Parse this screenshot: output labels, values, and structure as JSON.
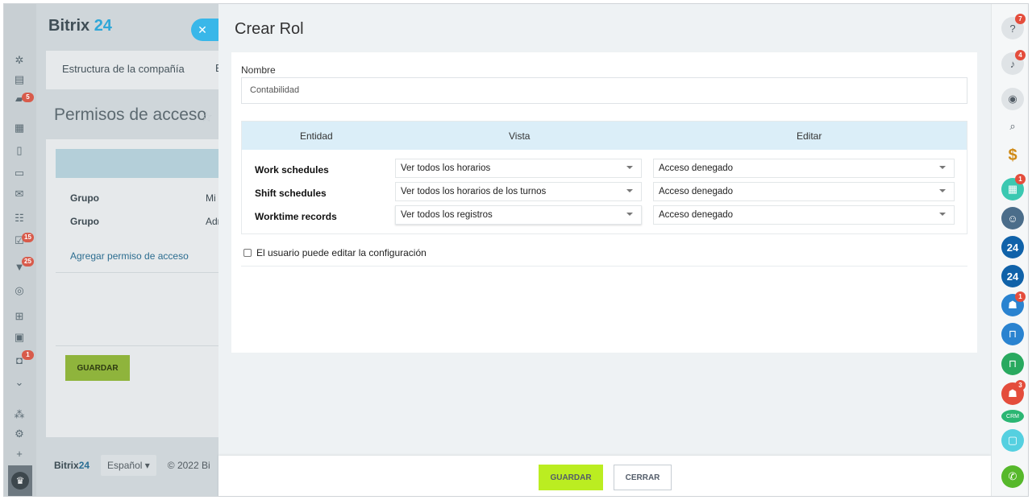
{
  "app": {
    "logo_name": "Bitrix",
    "logo_num": "24"
  },
  "background": {
    "tab_label": "Estructura de la compañía",
    "tab_label_partial": "E",
    "page_title": "Permisos de acceso",
    "rows": [
      {
        "label": "Grupo",
        "value": "Mi"
      },
      {
        "label": "Grupo",
        "value": "Adr"
      }
    ],
    "add_link": "Agregar permiso de acceso",
    "save_label": "GUARDAR",
    "footer": {
      "logo_name": "Bitrix",
      "logo_num": "24",
      "language": "Español",
      "copyright": "© 2022 Bi"
    }
  },
  "left_rail": {
    "badges": [
      "5",
      "15",
      "25",
      "1"
    ]
  },
  "panel": {
    "title": "Crear Rol",
    "name_label": "Nombre",
    "name_value": "Contabilidad",
    "table": {
      "headers": {
        "entity": "Entidad",
        "view": "Vista",
        "edit": "Editar"
      },
      "rows": [
        {
          "entity": "Work schedules",
          "view": "Ver todos los horarios",
          "edit": "Acceso denegado"
        },
        {
          "entity": "Shift schedules",
          "view": "Ver todos los horarios de los turnos",
          "edit": "Acceso denegado"
        },
        {
          "entity": "Worktime records",
          "view": "Ver todos los registros",
          "edit": "Acceso denegado"
        }
      ]
    },
    "checkbox_label": "El usuario puede editar la configuración",
    "save_label": "GUARDAR",
    "close_label": "CERRAR"
  },
  "right_rail": {
    "badges": {
      "help": "7",
      "notifications": "4",
      "calendar": "1",
      "group": "1",
      "crm_users": "3"
    },
    "crm_tag": "CRM",
    "b24_label": "24"
  },
  "colors": {
    "accent_green": "#bbed21",
    "header_blue": "#dbeef8",
    "badge_red": "#e44d3c",
    "bitrix_blue": "#2fa7d8"
  }
}
